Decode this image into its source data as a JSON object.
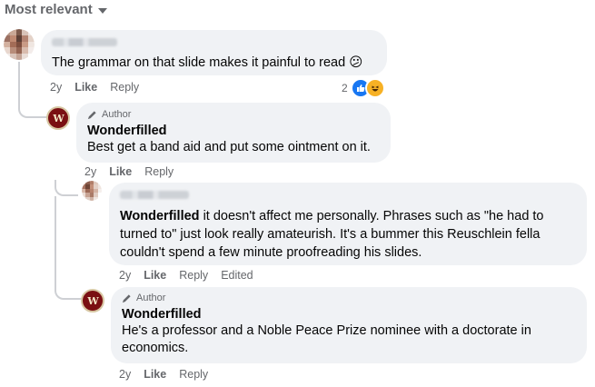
{
  "sort": {
    "label": "Most relevant"
  },
  "comments": [
    {
      "text": "The grammar on that slide makes it painful to read",
      "emoji": "😕",
      "time": "2y",
      "like": "Like",
      "reply": "Reply",
      "reaction_count": "2"
    },
    {
      "author_tag": "Author",
      "name": "Wonderfilled",
      "text": "Best get a band aid and put some ointment on it.",
      "time": "2y",
      "like": "Like",
      "reply": "Reply"
    },
    {
      "mention": "Wonderfilled",
      "text": " it doesn't affect me personally. Phrases such as \"he had to turned to\" just look really amateurish. It's a bummer this Reuschlein fella couldn't spend a few minute proofreading his slides.",
      "time": "2y",
      "like": "Like",
      "reply": "Reply",
      "edited": "Edited"
    },
    {
      "author_tag": "Author",
      "name": "Wonderfilled",
      "text": "He's a professor and a Noble Peace Prize nominee with a doctorate in economics.",
      "time": "2y",
      "like": "Like",
      "reply": "Reply"
    }
  ],
  "colors": {
    "bubble": "#f0f2f5",
    "meta": "#65676b",
    "like_blue": "#1877f2",
    "logo_red": "#7a0f12"
  },
  "icons": [
    "chevron-down-icon",
    "pencil-icon",
    "like-reaction-icon",
    "haha-reaction-icon"
  ]
}
